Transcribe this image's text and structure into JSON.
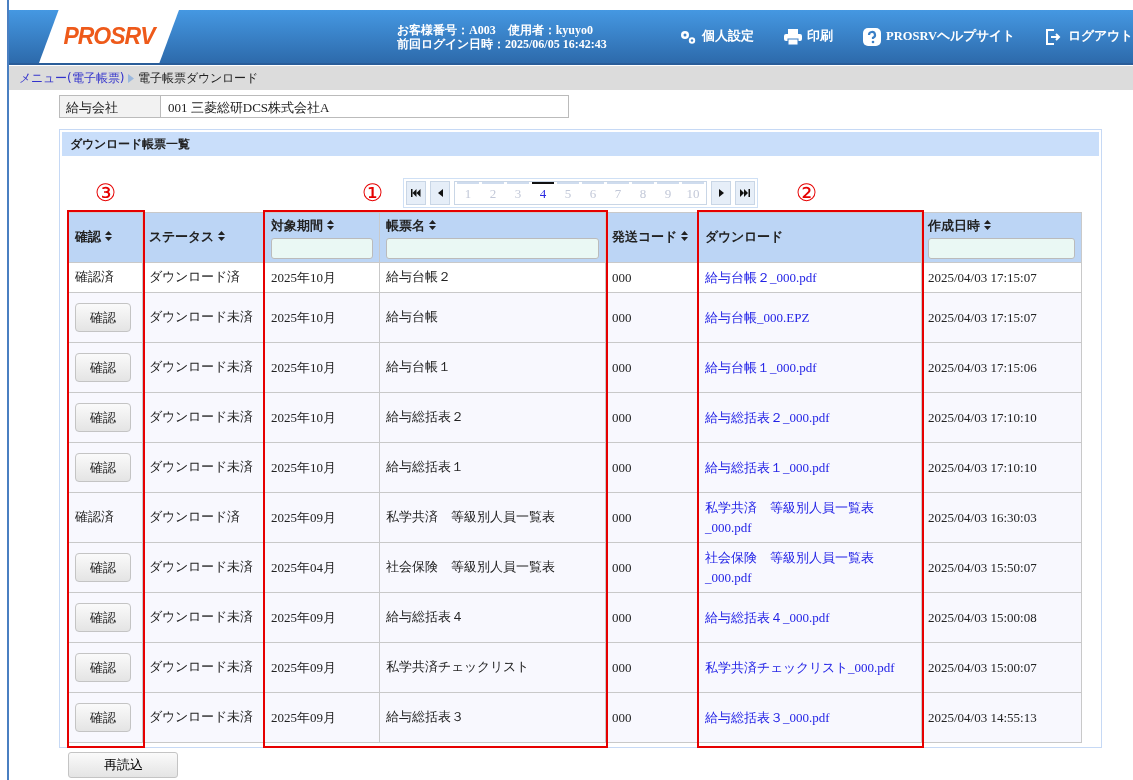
{
  "header": {
    "logo": "PROSRV",
    "info_lines": [
      "お客様番号：A003　使用者：kyuyo0",
      "前回ログイン日時：2025/06/05 16:42:43"
    ],
    "nav": [
      {
        "kind": "gear",
        "label": "個人設定"
      },
      {
        "kind": "printer",
        "label": "印刷"
      },
      {
        "kind": "help",
        "label": "PROSRVヘルプサイト"
      },
      {
        "kind": "logout",
        "label": "ログアウト"
      }
    ]
  },
  "breadcrumb": [
    {
      "label": "メニュー(電子帳票)",
      "link": true
    },
    {
      "label": "電子帳票ダウンロード",
      "link": false
    }
  ],
  "company": {
    "label": "給与会社",
    "value": "001 三菱総研DCS株式会社A"
  },
  "panel": {
    "title": "ダウンロード帳票一覧",
    "pager": [
      {
        "label": "1",
        "selected": false
      },
      {
        "label": "2",
        "selected": false
      },
      {
        "label": "3",
        "selected": false
      },
      {
        "label": "4",
        "selected": true
      },
      {
        "label": "5",
        "selected": false
      },
      {
        "label": "6",
        "selected": false
      },
      {
        "label": "7",
        "selected": false
      },
      {
        "label": "8",
        "selected": false
      },
      {
        "label": "9",
        "selected": false
      },
      {
        "label": "10",
        "selected": false
      }
    ],
    "columns": [
      {
        "label": "確認",
        "sortable": true,
        "filter": false,
        "boxed": true
      },
      {
        "label": "ステータス",
        "sortable": true,
        "filter": false,
        "boxed": false
      },
      {
        "label": "対象期間",
        "sortable": true,
        "filter": true,
        "boxed": true
      },
      {
        "label": "帳票名",
        "sortable": true,
        "filter": true,
        "boxed": true
      },
      {
        "label": "発送コード",
        "sortable": true,
        "filter": false,
        "boxed": false
      },
      {
        "label": "ダウンロード",
        "sortable": false,
        "filter": false,
        "boxed": true
      },
      {
        "label": "作成日時",
        "sortable": true,
        "filter": true,
        "boxed": false
      }
    ],
    "rows": [
      {
        "confirm": {
          "kind": "text",
          "label": "確認済"
        },
        "status": "ダウンロード済",
        "period": "2025年10月",
        "name": "給与台帳２",
        "code": "000",
        "file": "給与台帳２_000.pdf",
        "created": "2025/04/03 17:15:07"
      },
      {
        "confirm": {
          "kind": "button",
          "label": "確認"
        },
        "status": "ダウンロード未済",
        "period": "2025年10月",
        "name": "給与台帳",
        "code": "000",
        "file": "給与台帳_000.EPZ",
        "created": "2025/04/03 17:15:07"
      },
      {
        "confirm": {
          "kind": "button",
          "label": "確認"
        },
        "status": "ダウンロード未済",
        "period": "2025年10月",
        "name": "給与台帳１",
        "code": "000",
        "file": "給与台帳１_000.pdf",
        "created": "2025/04/03 17:15:06"
      },
      {
        "confirm": {
          "kind": "button",
          "label": "確認"
        },
        "status": "ダウンロード未済",
        "period": "2025年10月",
        "name": "給与総括表２",
        "code": "000",
        "file": "給与総括表２_000.pdf",
        "created": "2025/04/03 17:10:10"
      },
      {
        "confirm": {
          "kind": "button",
          "label": "確認"
        },
        "status": "ダウンロード未済",
        "period": "2025年10月",
        "name": "給与総括表１",
        "code": "000",
        "file": "給与総括表１_000.pdf",
        "created": "2025/04/03 17:10:10"
      },
      {
        "confirm": {
          "kind": "text",
          "label": "確認済"
        },
        "status": "ダウンロード済",
        "period": "2025年09月",
        "name": "私学共済　等級別人員一覧表",
        "code": "000",
        "file": "私学共済　等級別人員一覧表_000.pdf",
        "created": "2025/04/03 16:30:03"
      },
      {
        "confirm": {
          "kind": "button",
          "label": "確認"
        },
        "status": "ダウンロード未済",
        "period": "2025年04月",
        "name": "社会保険　等級別人員一覧表",
        "code": "000",
        "file": "社会保険　等級別人員一覧表_000.pdf",
        "created": "2025/04/03 15:50:07"
      },
      {
        "confirm": {
          "kind": "button",
          "label": "確認"
        },
        "status": "ダウンロード未済",
        "period": "2025年09月",
        "name": "給与総括表４",
        "code": "000",
        "file": "給与総括表４_000.pdf",
        "created": "2025/04/03 15:00:08"
      },
      {
        "confirm": {
          "kind": "button",
          "label": "確認"
        },
        "status": "ダウンロード未済",
        "period": "2025年09月",
        "name": "私学共済チェックリスト",
        "code": "000",
        "file": "私学共済チェックリスト_000.pdf",
        "created": "2025/04/03 15:00:07"
      },
      {
        "confirm": {
          "kind": "button",
          "label": "確認"
        },
        "status": "ダウンロード未済",
        "period": "2025年09月",
        "name": "給与総括表３",
        "code": "000",
        "file": "給与総括表３_000.pdf",
        "created": "2025/04/03 14:55:13"
      }
    ],
    "annotations": [
      {
        "number": "③"
      },
      {
        "number": "①"
      },
      {
        "number": "②"
      }
    ]
  },
  "reload_button": "再読込"
}
